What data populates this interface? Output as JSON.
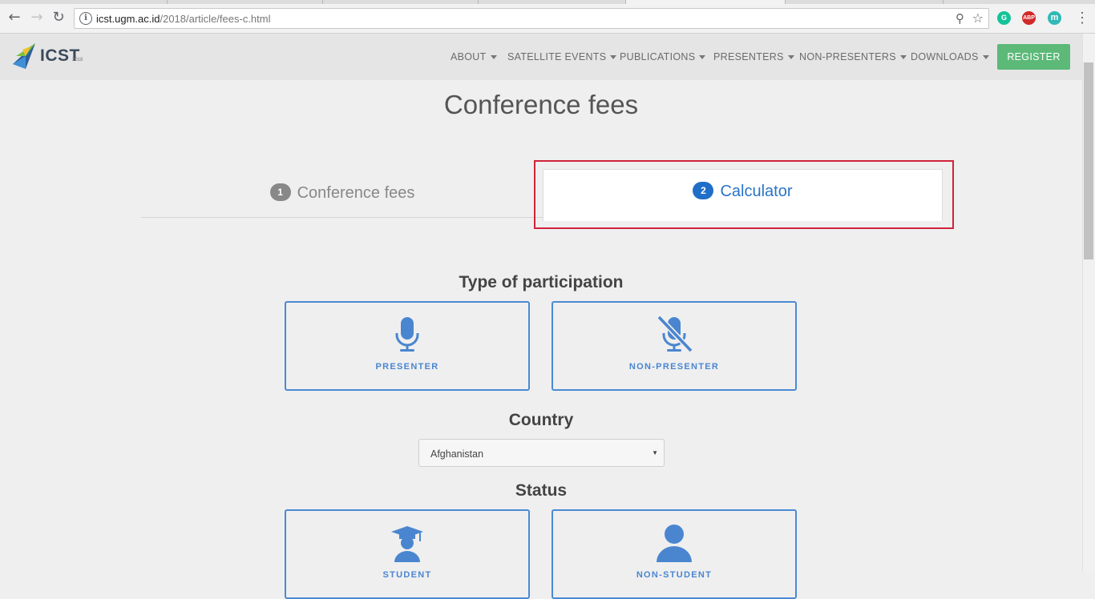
{
  "browser": {
    "url_host": "icst.ugm.ac.id",
    "url_path": "/2018/article/fees-c.html",
    "extensions": [
      {
        "name": "grammarly-icon",
        "label": "G",
        "color": "#15c39a"
      },
      {
        "name": "adblock-icon",
        "label": "ABP",
        "color": "#d12a2a"
      },
      {
        "name": "mendeley-icon",
        "label": "m",
        "color": "#2fb9b7"
      }
    ]
  },
  "header": {
    "logo_text": "ICST",
    "logo_year": "2018",
    "nav": [
      {
        "label": "ABOUT"
      },
      {
        "label": "SATELLITE EVENTS"
      },
      {
        "label": "PUBLICATIONS"
      },
      {
        "label": "PRESENTERS"
      },
      {
        "label": "NON-PRESENTERS"
      },
      {
        "label": "DOWNLOADS"
      }
    ],
    "register_label": "REGISTER",
    "register_color": "#5cb978"
  },
  "page": {
    "title": "Conference fees",
    "tabs": [
      {
        "number": "1",
        "label": "Conference fees",
        "active": false
      },
      {
        "number": "2",
        "label": "Calculator",
        "active": true
      }
    ],
    "participation": {
      "title": "Type of participation",
      "options": [
        {
          "label": "PRESENTER",
          "icon": "microphone-icon"
        },
        {
          "label": "NON-PRESENTER",
          "icon": "microphone-off-icon"
        }
      ]
    },
    "country": {
      "title": "Country",
      "selected": "Afghanistan"
    },
    "status": {
      "title": "Status",
      "options": [
        {
          "label": "STUDENT",
          "icon": "graduation-cap-icon"
        },
        {
          "label": "NON-STUDENT",
          "icon": "user-icon"
        }
      ]
    }
  },
  "colors": {
    "accent_blue": "#4b8ad3",
    "highlight_red": "#d0233a"
  }
}
